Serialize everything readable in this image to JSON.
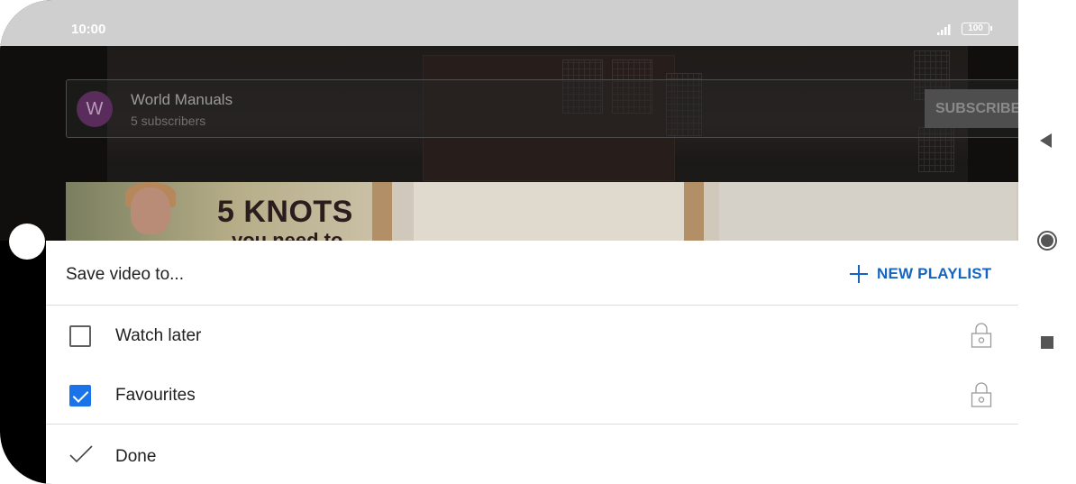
{
  "status_bar": {
    "time": "10:00",
    "battery": "100",
    "signal_icon": "signal-icon"
  },
  "channel": {
    "avatar_letter": "W",
    "name": "World Manuals",
    "subscribers": "5 subscribers",
    "subscribe_label": "SUBSCRIBE"
  },
  "thumbnail": {
    "title": "5 KNOTS",
    "subtitle": "you need to"
  },
  "sheet": {
    "title": "Save video to...",
    "new_playlist_label": "NEW PLAYLIST",
    "playlists": [
      {
        "label": "Watch later",
        "checked": false,
        "icon": "lock-icon"
      },
      {
        "label": "Favourites",
        "checked": true,
        "icon": "lock-icon"
      }
    ],
    "done_label": "Done"
  },
  "nav": {
    "back": "back-icon",
    "home": "home-icon",
    "recents": "recents-icon"
  },
  "colors": {
    "accent": "#1565c0",
    "checkbox_checked": "#1a73e8"
  }
}
